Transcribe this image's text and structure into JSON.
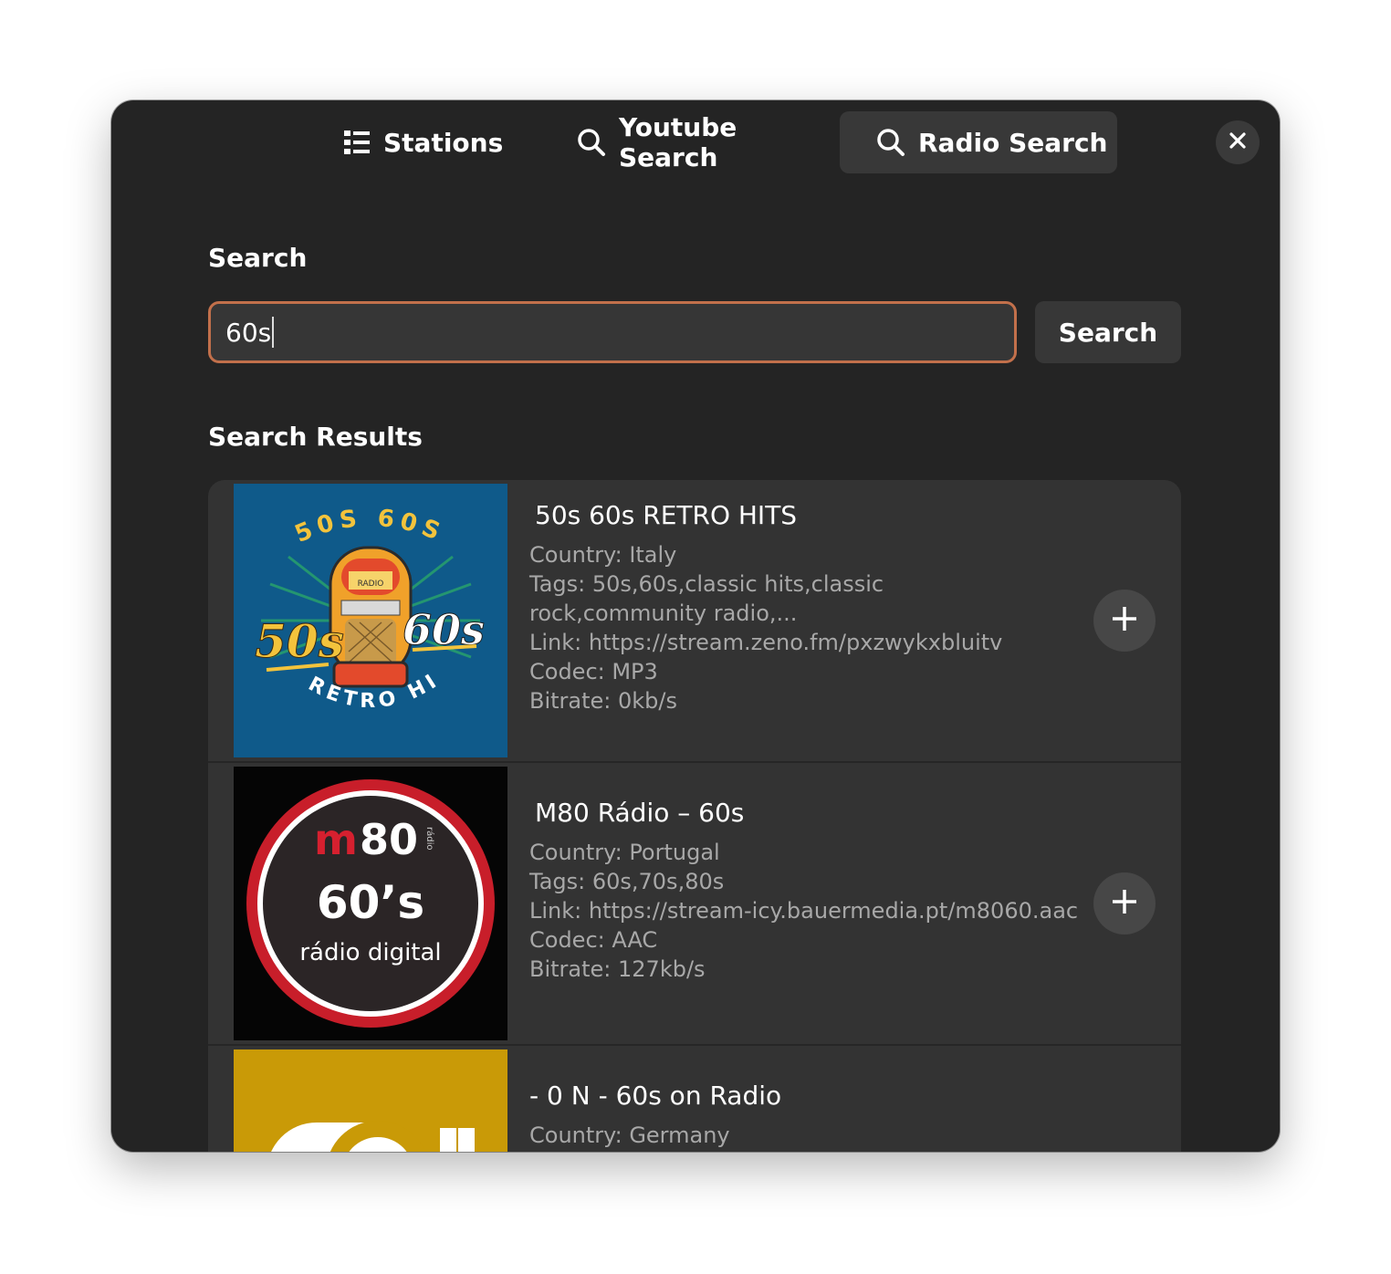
{
  "tabs": [
    {
      "label": "Stations",
      "icon": "list-icon"
    },
    {
      "label": "Youtube Search",
      "icon": "search-icon"
    },
    {
      "label": "Radio Search",
      "icon": "search-icon",
      "active": true
    }
  ],
  "search": {
    "heading": "Search",
    "value": "60s",
    "button_label": "Search"
  },
  "results": {
    "heading": "Search Results",
    "items": [
      {
        "name": "50s 60s RETRO HITS",
        "country": "Country: Italy",
        "tags": "Tags: 50s,60s,classic hits,classic rock,community radio,...",
        "link": "Link: https://stream.zeno.fm/pxzwykxbluitv",
        "codec": "Codec: MP3",
        "bitrate": "Bitrate: 0kb/s",
        "logo": {
          "top_text": "50S 60S",
          "left_text": "50s",
          "right_text": "60s",
          "bottom_text": "RETRO HITS",
          "badge_text": "RADIO",
          "bg_color": "#0f5a8a"
        }
      },
      {
        "name": "M80 Rádio – 60s",
        "country": "Country: Portugal",
        "tags": "Tags: 60s,70s,80s",
        "link": "Link: https://stream-icy.bauermedia.pt/m8060.aac",
        "codec": "Codec: AAC",
        "bitrate": "Bitrate: 127kb/s",
        "logo": {
          "brand_m": "m",
          "brand_num": "80",
          "brand_side": "rádio",
          "big_text": "60’s",
          "bottom_text": "rádio digital",
          "ring_color": "#c81e2a"
        }
      },
      {
        "name": "- 0 N - 60s on Radio",
        "country": "Country: Germany",
        "logo": {
          "bg_color": "#c99a07"
        }
      }
    ]
  },
  "colors": {
    "accent_focus": "#c2704b",
    "window_bg": "#242424",
    "card_bg": "#333333"
  }
}
